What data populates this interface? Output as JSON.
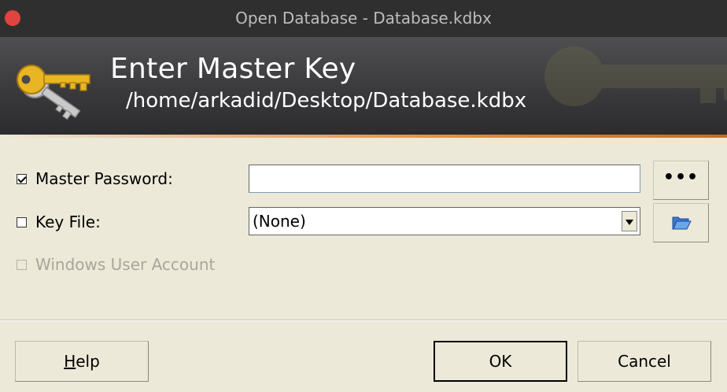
{
  "window": {
    "title": "Open Database - Database.kdbx"
  },
  "banner": {
    "title": "Enter Master Key",
    "path": "/home/arkadid/Desktop/Database.kdbx",
    "icon": "key-icon"
  },
  "form": {
    "master_password": {
      "label": "Master Password:",
      "checked": true,
      "value": "",
      "reveal_button_label": "•••"
    },
    "key_file": {
      "label": "Key File:",
      "checked": false,
      "selected": "(None)",
      "browse_icon": "folder-open-icon"
    },
    "windows_user_account": {
      "label": "Windows User Account",
      "checked": false,
      "enabled": false
    }
  },
  "buttons": {
    "help": "Help",
    "ok": "OK",
    "cancel": "Cancel"
  },
  "colors": {
    "titlebar": "#2f2f2f",
    "close": "#e0443e",
    "banner_dark": "#2c2c2e",
    "accent_orange": "#e0852c",
    "dialog_bg": "#ece9d8"
  }
}
